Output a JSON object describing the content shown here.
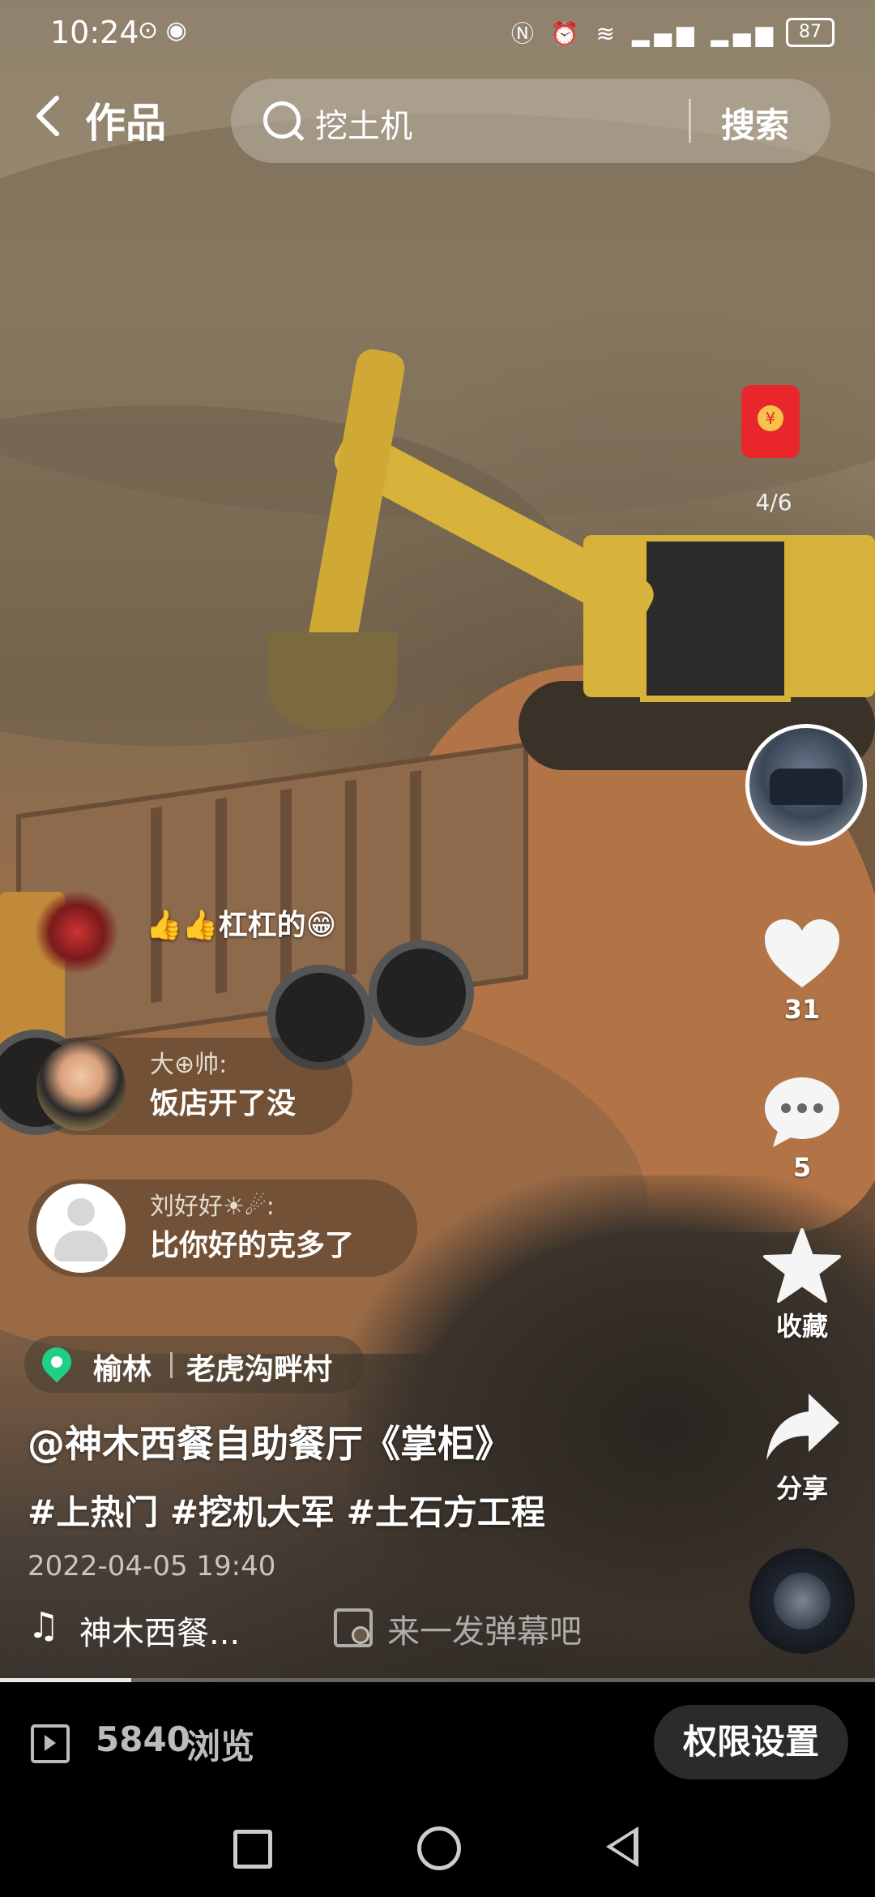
{
  "status_bar": {
    "time": "10:24",
    "left_icons": [
      "car-mode-icon",
      "eye-icon"
    ],
    "right_icons": [
      "nfc-icon",
      "alarm-icon",
      "wifi-icon",
      "signal-5g-icon",
      "signal-4g-icon"
    ],
    "battery": "87"
  },
  "header": {
    "title": "作品",
    "search_query": "挖土机",
    "search_button": "搜索"
  },
  "right_rail": {
    "red_packet_progress": "4/6",
    "like_count": "31",
    "comment_count": "5",
    "favorite_label": "收藏",
    "share_label": "分享"
  },
  "bullet_comments": [
    {
      "text": "👍👍杠杠的😁"
    }
  ],
  "comments": [
    {
      "name": "大⊕帅:",
      "message": "饭店开了没"
    },
    {
      "name": "刘好好☀☄:",
      "message": "比你好的克多了"
    }
  ],
  "post": {
    "location_city": "榆林",
    "location_place": "老虎沟畔村",
    "author": "@神木西餐自助餐厅《掌柜》",
    "hashtags": "#上热门 #挖机大军 #土石方工程",
    "date": "2022-04-05 19:40",
    "music": "神木西餐...",
    "danmu_placeholder": "来一发弹幕吧",
    "progress": 0.15
  },
  "bottom_bar": {
    "views_count": "5840",
    "views_label": "浏览",
    "permission_button": "权限设置"
  },
  "colors": {
    "location_pin": "#1fcf86",
    "red_packet": "#e8262b",
    "bottom_bar_bg": "#000000"
  }
}
